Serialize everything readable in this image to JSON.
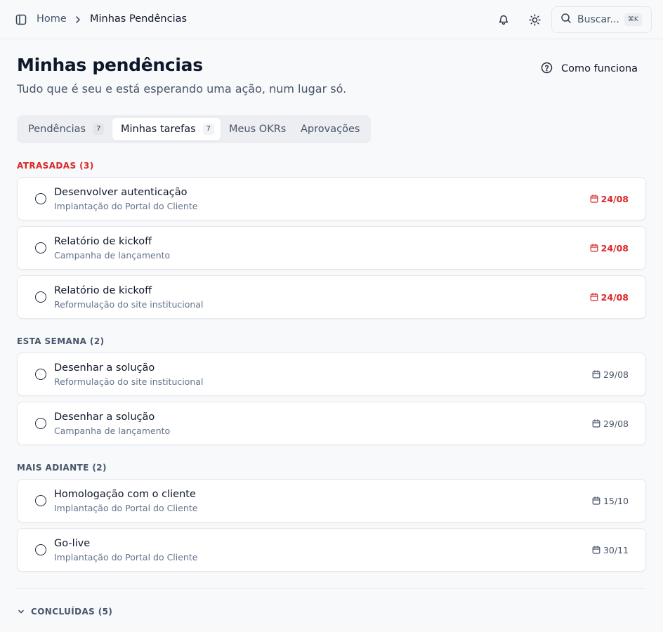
{
  "breadcrumb": {
    "home": "Home",
    "current": "Minhas Pendências"
  },
  "search": {
    "placeholder": "Buscar...",
    "shortcut": "⌘K"
  },
  "header": {
    "title": "Minhas pendências",
    "subtitle": "Tudo que é seu e está esperando uma ação, num lugar só.",
    "help_label": "Como funciona"
  },
  "tabs": [
    {
      "label": "Pendências",
      "count": "7",
      "active": false
    },
    {
      "label": "Minhas tarefas",
      "count": "7",
      "active": true
    },
    {
      "label": "Meus OKRs",
      "active": false
    },
    {
      "label": "Aprovações",
      "active": false
    }
  ],
  "sections": {
    "overdue": {
      "label": "ATRASADAS (3)",
      "tasks": [
        {
          "title": "Desenvolver autenticação",
          "project": "Implantação do Portal do Cliente",
          "date": "24/08"
        },
        {
          "title": "Relatório de kickoff",
          "project": "Campanha de lançamento",
          "date": "24/08"
        },
        {
          "title": "Relatório de kickoff",
          "project": "Reformulação do site institucional",
          "date": "24/08"
        }
      ]
    },
    "this_week": {
      "label": "ESTA SEMANA (2)",
      "tasks": [
        {
          "title": "Desenhar a solução",
          "project": "Reformulação do site institucional",
          "date": "29/08"
        },
        {
          "title": "Desenhar a solução",
          "project": "Campanha de lançamento",
          "date": "29/08"
        }
      ]
    },
    "later": {
      "label": "MAIS ADIANTE (2)",
      "tasks": [
        {
          "title": "Homologação com o cliente",
          "project": "Implantação do Portal do Cliente",
          "date": "15/10"
        },
        {
          "title": "Go-live",
          "project": "Implantação do Portal do Cliente",
          "date": "30/11"
        }
      ]
    },
    "completed": {
      "label": "CONCLUÍDAS (5)"
    }
  },
  "colors": {
    "overdue": "#dc2626",
    "text": "#0f172a",
    "muted": "#475569",
    "border": "#e5e7eb"
  },
  "icons": [
    "sidebar-toggle-icon",
    "chevron-right-icon",
    "bell-icon",
    "sun-icon",
    "search-icon",
    "help-circle-icon",
    "calendar-icon",
    "chevron-down-icon"
  ]
}
